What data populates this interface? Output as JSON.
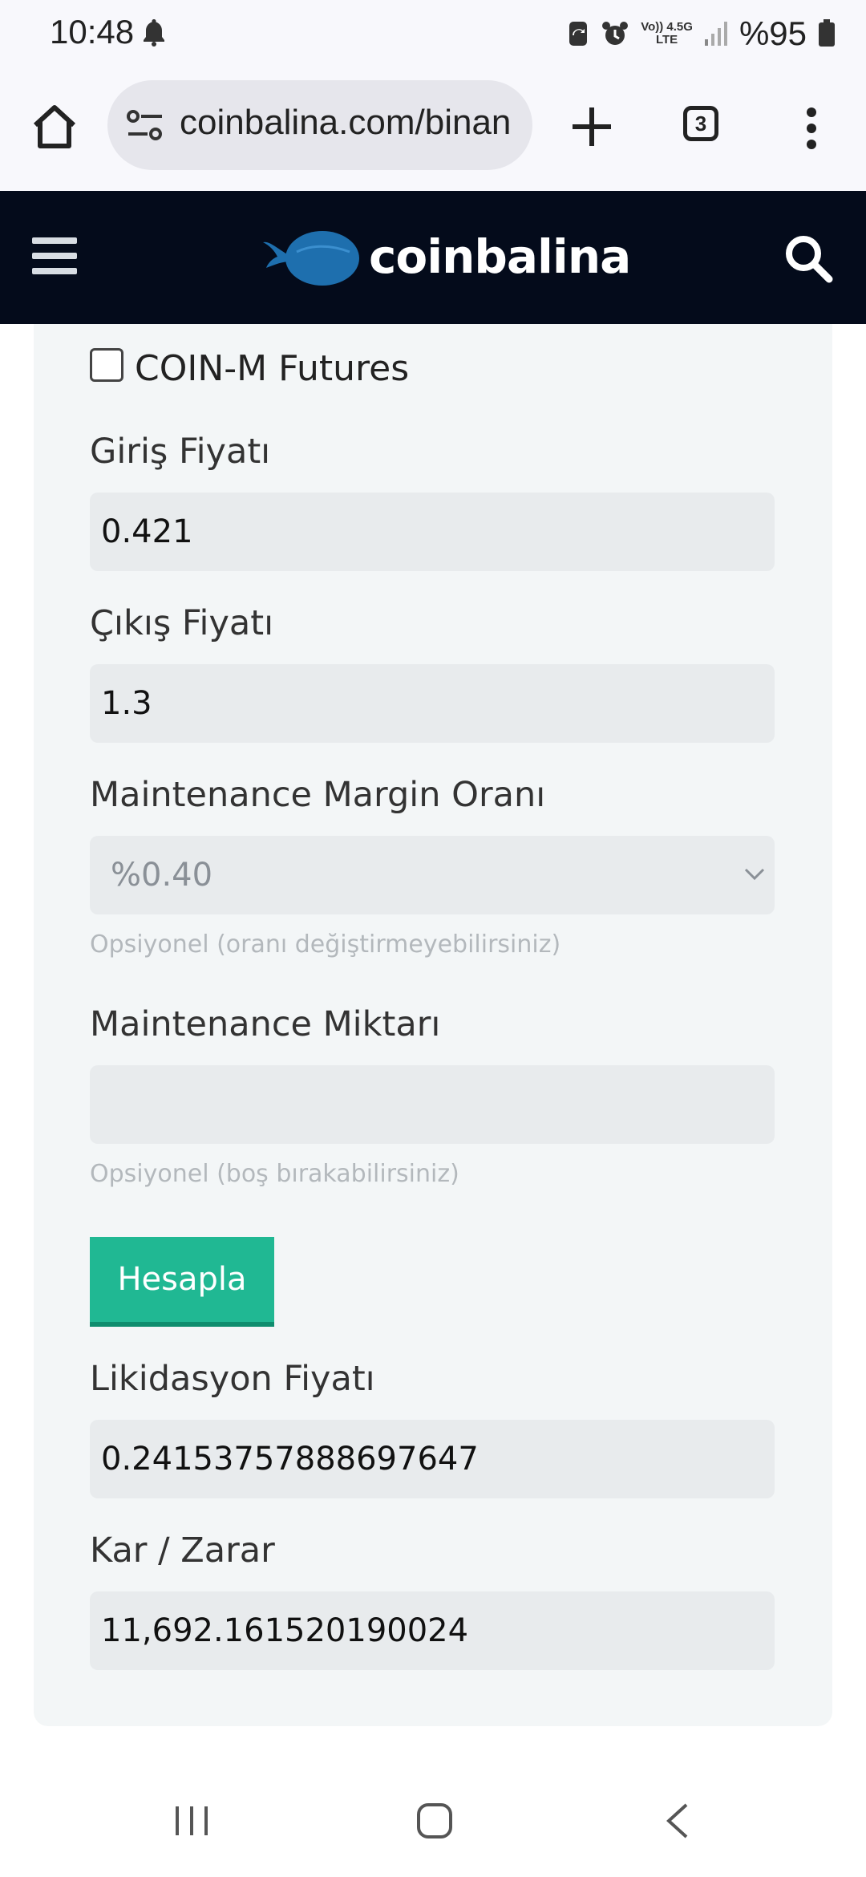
{
  "status_bar": {
    "time": "10:48",
    "network_top": "Vo)) 4.5G",
    "network_bottom": "LTE",
    "battery": "%95",
    "icons": [
      "bell-icon",
      "sync-icon",
      "alarm-icon",
      "signal-icon",
      "battery-icon"
    ]
  },
  "browser": {
    "url": "coinbalina.com/binan",
    "tab_count": "3",
    "icons": [
      "home-icon",
      "site-settings-icon",
      "plus-icon",
      "more-vert-icon"
    ]
  },
  "site": {
    "logo_text": "coinbalina",
    "brand_color": "#1e6fae",
    "icons": [
      "hamburger-icon",
      "whale-logo-icon",
      "search-icon"
    ]
  },
  "form": {
    "coin_m_label": "COIN-M Futures",
    "coin_m_checked": false,
    "entry_price_label": "Giriş Fiyatı",
    "entry_price_value": "0.421",
    "exit_price_label": "Çıkış Fiyatı",
    "exit_price_value": "1.3",
    "mm_rate_label": "Maintenance Margin Oranı",
    "mm_rate_value": "%0.40",
    "mm_rate_hint": "Opsiyonel (oranı değiştirmeyebilirsiniz)",
    "mm_amount_label": "Maintenance Miktarı",
    "mm_amount_value": "",
    "mm_amount_hint": "Opsiyonel (boş bırakabilirsiniz)",
    "calculate_button": "Hesapla",
    "liquidation_label": "Likidasyon Fiyatı",
    "liquidation_value": "0.24153757888697647",
    "pnl_label": "Kar / Zarar",
    "pnl_value": "11,692.161520190024",
    "button_color": "#20b893"
  },
  "nav": {
    "icons": [
      "recent-apps-icon",
      "home-circle-icon",
      "back-icon"
    ]
  }
}
